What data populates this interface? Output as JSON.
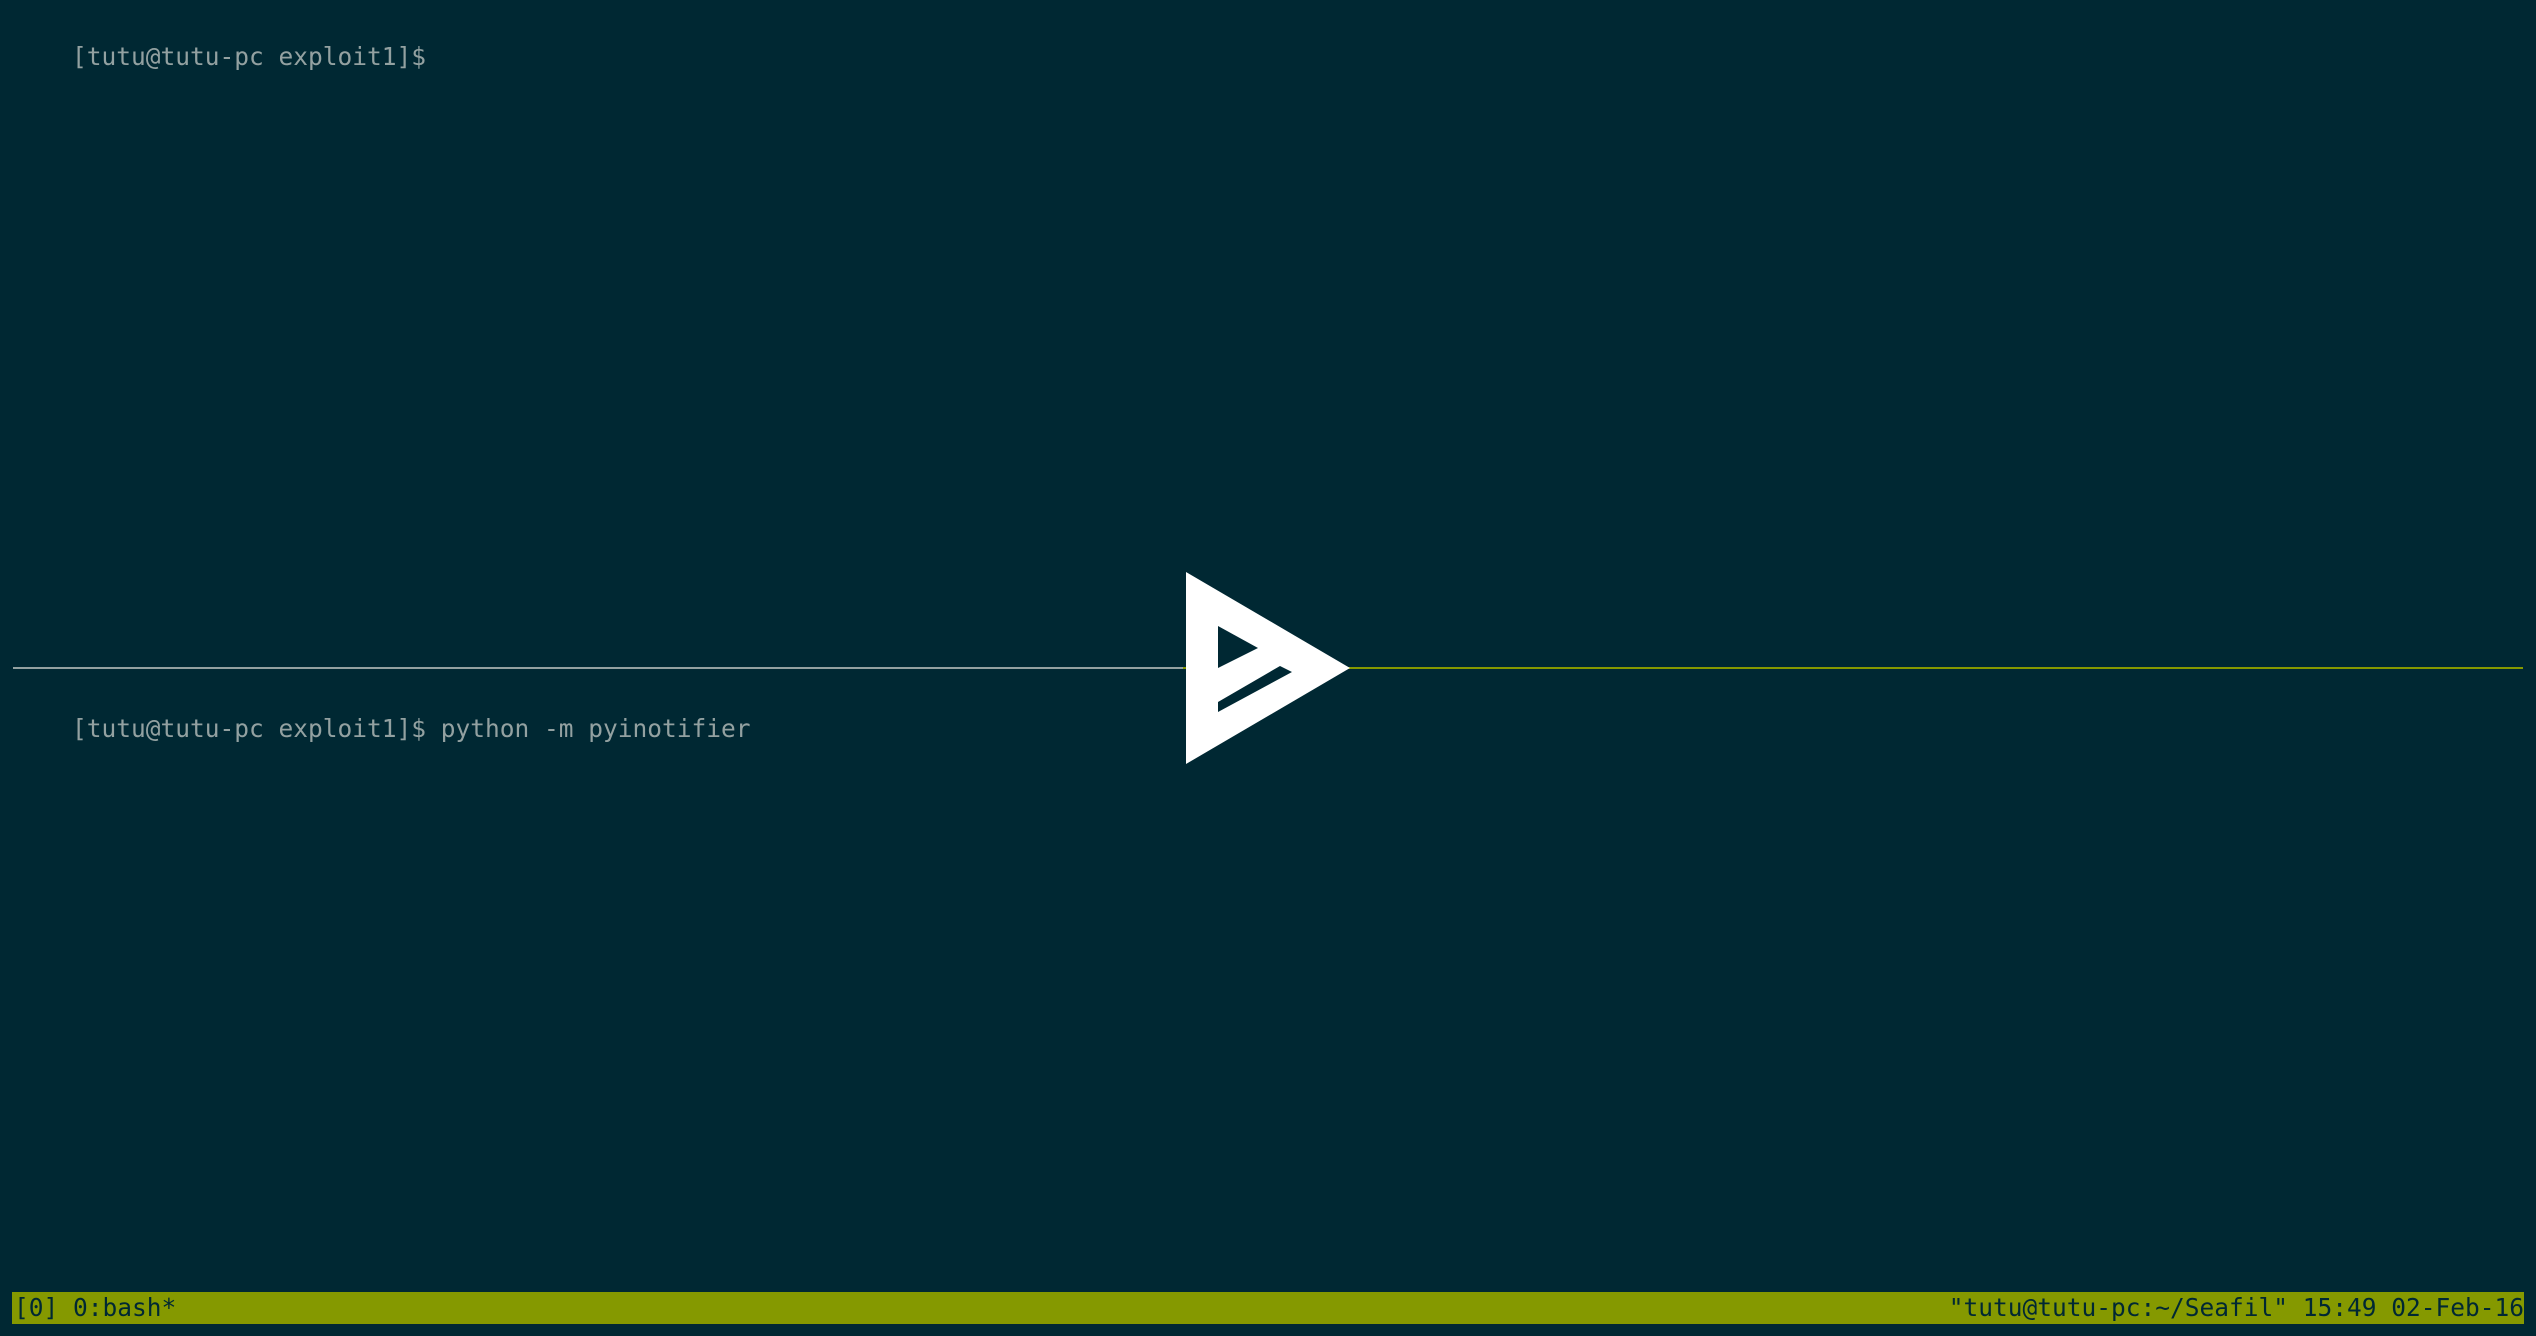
{
  "top_pane": {
    "prompt": "[tutu@tutu-pc exploit1]$"
  },
  "bottom_pane": {
    "prompt": "[tutu@tutu-pc exploit1]$",
    "command": " python -m pyinotifier"
  },
  "status_bar": {
    "left": "[0] 0:bash*",
    "right": "\"tutu@tutu-pc:~/Seafil\" 15:49 02-Feb-16"
  },
  "overlay": {
    "icon": "play-icon"
  },
  "colors": {
    "background": "#002833",
    "text": "#93a1a1",
    "accent": "#859900"
  }
}
